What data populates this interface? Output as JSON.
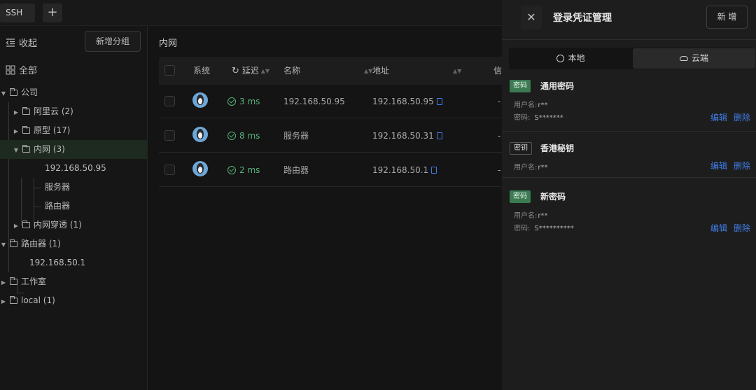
{
  "tabs": {
    "active": "SSH",
    "add_symbol": "+"
  },
  "sidebar": {
    "collapse_label": "收起",
    "add_group_label": "新增分组",
    "all_label": "全部",
    "tree": [
      {
        "label": "公司",
        "level": 0,
        "type": "folder",
        "expanded": true
      },
      {
        "label": "阿里云 (2)",
        "level": 1,
        "type": "folder",
        "expanded": false
      },
      {
        "label": "原型 (17)",
        "level": 1,
        "type": "folder",
        "expanded": false
      },
      {
        "label": "内网 (3)",
        "level": 1,
        "type": "folder",
        "expanded": true,
        "selected": true
      },
      {
        "label": "192.168.50.95",
        "level": 2,
        "type": "host"
      },
      {
        "label": "服务器",
        "level": 2,
        "type": "host"
      },
      {
        "label": "路由器",
        "level": 2,
        "type": "host"
      },
      {
        "label": "内网穿透 (1)",
        "level": 1,
        "type": "folder",
        "expanded": false
      },
      {
        "label": "路由器 (1)",
        "level": 0,
        "type": "folder",
        "expanded": true
      },
      {
        "label": "192.168.50.1",
        "level": 1,
        "type": "host"
      },
      {
        "label": "工作室",
        "level": 0,
        "type": "folder",
        "expanded": false
      },
      {
        "label": "local (1)",
        "level": 0,
        "type": "folder",
        "expanded": false
      }
    ]
  },
  "main": {
    "section_title": "内网",
    "columns": {
      "system": "系统",
      "latency": "延迟",
      "name": "名称",
      "address": "地址",
      "info": "信"
    },
    "rows": [
      {
        "latency": "3 ms",
        "name": "192.168.50.95",
        "address": "192.168.50.95",
        "trail": "-"
      },
      {
        "latency": "8 ms",
        "name": "服务器",
        "address": "192.168.50.31",
        "trail": "-"
      },
      {
        "latency": "2 ms",
        "name": "路由器",
        "address": "192.168.50.1",
        "trail": "-"
      }
    ]
  },
  "drawer": {
    "close_symbol": "✕",
    "title": "登录凭证管理",
    "new_label": "新 增",
    "seg_local": "本地",
    "seg_cloud": "云端",
    "credentials": [
      {
        "badge": "密码",
        "badge_style": "green",
        "name": "通用密码",
        "user_label": "用户名:",
        "user": "r**",
        "pass_label": "密码:",
        "pass": "S*******",
        "edit": "编辑",
        "delete": "删除"
      },
      {
        "badge": "密钥",
        "badge_style": "outline",
        "name": "香港秘钥",
        "user_label": "用户名:",
        "user": "r**",
        "edit": "编辑",
        "delete": "删除"
      },
      {
        "badge": "密码",
        "badge_style": "green",
        "name": "新密码",
        "user_label": "用户名:",
        "user": "r**",
        "pass_label": "密码:",
        "pass": "S**********",
        "edit": "编辑",
        "delete": "删除"
      }
    ]
  },
  "colors": {
    "accent_blue": "#3f7ee8",
    "success_green": "#56b27a",
    "badge_green": "#3c7a52"
  }
}
